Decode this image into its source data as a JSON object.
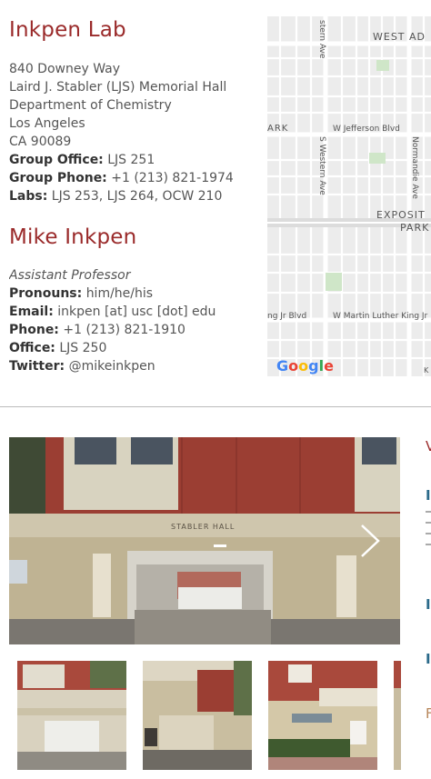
{
  "lab": {
    "title": "Inkpen Lab",
    "address": [
      "840 Downey Way",
      "Laird J. Stabler (LJS) Memorial Hall",
      "Department of Chemistry",
      "Los Angeles",
      "CA 90089"
    ],
    "group_office_label": "Group Office:",
    "group_office_value": "LJS 251",
    "group_phone_label": "Group Phone:",
    "group_phone_value": "+1 (213) 821-1974",
    "labs_label": "Labs:",
    "labs_value": "LJS 253, LJS 264, OCW 210"
  },
  "person": {
    "name": "Mike Inkpen",
    "role": "Assistant Professor",
    "pronouns_label": "Pronouns:",
    "pronouns_value": "him/he/his",
    "email_label": "Email:",
    "email_value": "inkpen [at] usc [dot] edu",
    "phone_label": "Phone:",
    "phone_value": "+1 (213) 821-1910",
    "office_label": "Office:",
    "office_value": "LJS 250",
    "twitter_label": "Twitter:",
    "twitter_value": "@mikeinkpen"
  },
  "map": {
    "labels": {
      "west_adams": "WEST AD",
      "western_ave_top": "stern Ave",
      "park": "ARK",
      "jefferson": "W Jefferson Blvd",
      "s_western": "S Western Ave",
      "normandie": "Normandie Ave",
      "exposition": "EXPOSIT",
      "park2": "PARK",
      "mlk_left": "ng Jr Blvd",
      "mlk_right": "W Martin Luther King Jr",
      "google": "Google",
      "corner": "K"
    }
  },
  "gallery": {
    "sign_text": "STABLER HALL",
    "next_icon": "chevron-right-icon",
    "right_panel_fragments": [
      "V",
      "I",
      "I",
      "I",
      "F"
    ]
  },
  "colors": {
    "accent": "#9a2a2a",
    "text": "#555555",
    "link_blue": "#2b6a8a"
  }
}
